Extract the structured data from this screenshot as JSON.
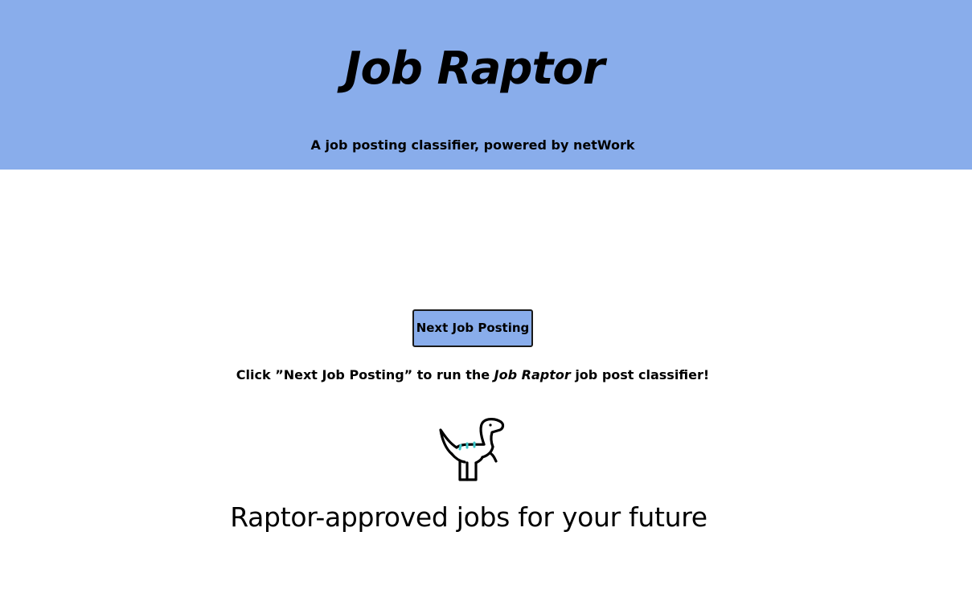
{
  "header": {
    "title": "Job Raptor",
    "subtitle": "A job posting classifier, powered by netWork",
    "background_color": "#89adeb"
  },
  "main": {
    "next_button_label": "Next Job Posting",
    "instructions": {
      "prefix": "Click ”Next Job Posting” to run the ",
      "brand": "Job Raptor",
      "suffix": " job post classifier!"
    },
    "mascot_icon": "dinosaur-icon",
    "tagline": "Raptor-approved jobs for your future",
    "accent_color": "#3cc6c8"
  }
}
